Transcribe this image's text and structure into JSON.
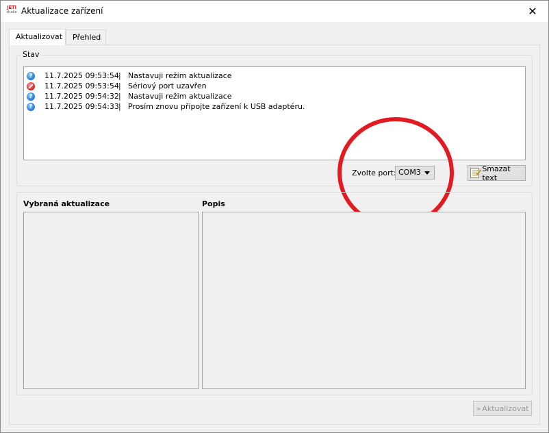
{
  "window": {
    "title": "Aktualizace zařízení",
    "logo_top": "JETI",
    "logo_bottom": "studio",
    "close_glyph": "✕"
  },
  "tabs": [
    {
      "label": "Aktualizovat",
      "active": true
    },
    {
      "label": "Přehled",
      "active": false
    }
  ],
  "status_group": {
    "title": "Stav",
    "log": [
      {
        "icon": "info-icon",
        "time": "11.7.2025 09:53:54",
        "sep": "|",
        "message": "Nastavuji režim aktualizace"
      },
      {
        "icon": "error-icon",
        "time": "11.7.2025 09:53:54",
        "sep": "|",
        "message": "Sériový port uzavřen"
      },
      {
        "icon": "info-icon",
        "time": "11.7.2025 09:54:32",
        "sep": "|",
        "message": "Nastavuji režim aktualizace"
      },
      {
        "icon": "info-icon",
        "time": "11.7.2025 09:54:33",
        "sep": "|",
        "message": "Prosím znovu připojte zařízení k USB adaptéru."
      }
    ],
    "port_label": "Zvolte port:",
    "port_value": "COM3",
    "clear_button": "Smazat text"
  },
  "update_group": {
    "selected_label": "Vybraná aktualizace",
    "description_label": "Popis"
  },
  "footer": {
    "update_button": "Aktualizovat",
    "update_chevron": "»"
  },
  "colors": {
    "annotation_circle": "#e21b23",
    "info_icon": "#1c74d8",
    "error_icon": "#d11b1b"
  }
}
